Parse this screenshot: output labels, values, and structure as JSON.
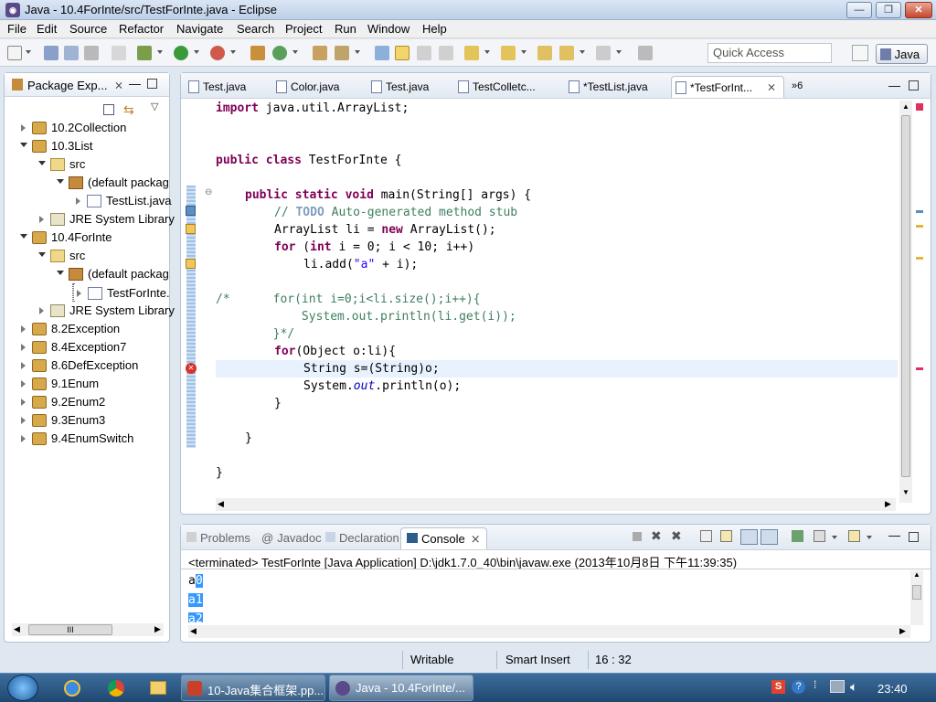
{
  "window": {
    "title": "Java - 10.4ForInte/src/TestForInte.java - Eclipse",
    "minimize": "—",
    "maximize": "❐",
    "close": "✕"
  },
  "menu": [
    "File",
    "Edit",
    "Source",
    "Refactor",
    "Navigate",
    "Search",
    "Project",
    "Run",
    "Window",
    "Help"
  ],
  "toolbar": {
    "quick_access_placeholder": "Quick Access",
    "perspective": "Java"
  },
  "package_explorer": {
    "title": "Package Exp...",
    "items": [
      {
        "label": "10.2Collection"
      },
      {
        "label": "10.3List"
      },
      {
        "label": "src"
      },
      {
        "label": "(default packag"
      },
      {
        "label": "TestList.java"
      },
      {
        "label": "JRE System Library"
      },
      {
        "label": "10.4ForInte"
      },
      {
        "label": "src"
      },
      {
        "label": "(default packag"
      },
      {
        "label": "TestForInte."
      },
      {
        "label": "JRE System Library"
      },
      {
        "label": "8.2Exception"
      },
      {
        "label": "8.4Exception7"
      },
      {
        "label": "8.6DefException"
      },
      {
        "label": "9.1Enum"
      },
      {
        "label": "9.2Enum2"
      },
      {
        "label": "9.3Enum3"
      },
      {
        "label": "9.4EnumSwitch"
      }
    ],
    "hscroll_thumb": "III"
  },
  "editor": {
    "tabs": [
      "Test.java",
      "Color.java",
      "Test.java",
      "TestColletc...",
      "*TestList.java",
      "*TestForInt..."
    ],
    "overflow": "»6",
    "code": {
      "l1a": "import",
      "l1b": " java.util.ArrayList;",
      "l2a": "public",
      "l2b": "class",
      "l2c": " TestForInte {",
      "l3a": "public",
      "l3b": "static",
      "l3c": "void",
      "l3d": " main(String[] args) {",
      "l4a": "// ",
      "l4b": "TODO",
      "l4c": " Auto-generated method stub",
      "l5a": "ArrayList li = ",
      "l5b": "new",
      "l5c": " ArrayList();",
      "l6a": "for",
      "l6b": " (",
      "l6c": "int",
      "l6d": " i = 0; i < 10; i++)",
      "l7a": "li.add(",
      "l7b": "\"a\"",
      "l7c": " + i);",
      "l8": "/*      for(int i=0;i<li.size();i++){",
      "l9": "            System.out.println(li.get(i));",
      "l10": "        }*/",
      "l11a": "for",
      "l11b": "(Object o:li){",
      "l12": "String s=(String)o;",
      "l13a": "System.",
      "l13b": "out",
      "l13c": ".println(o);",
      "l14": "}",
      "l15": "}",
      "l16": "}"
    }
  },
  "console": {
    "tabs": {
      "problems": "Problems",
      "javadoc": "Javadoc",
      "declaration": "Declaration",
      "console": "Console"
    },
    "header": "<terminated> TestForInte [Java Application] D:\\jdk1.7.0_40\\bin\\javaw.exe (2013年10月8日 下午11:39:35)",
    "output": [
      {
        "pre": "a",
        "sel": "0"
      },
      {
        "pre": "",
        "sel": "a1"
      },
      {
        "pre": "",
        "sel": "a2"
      }
    ]
  },
  "status": {
    "writable": "Writable",
    "insert": "Smart Insert",
    "position": "16 : 32"
  },
  "taskbar": {
    "tasks": [
      "10-Java集合框架.pp...",
      "Java - 10.4ForInte/..."
    ],
    "clock": "23:40",
    "colors": {
      "accent": "#3399ff"
    }
  }
}
